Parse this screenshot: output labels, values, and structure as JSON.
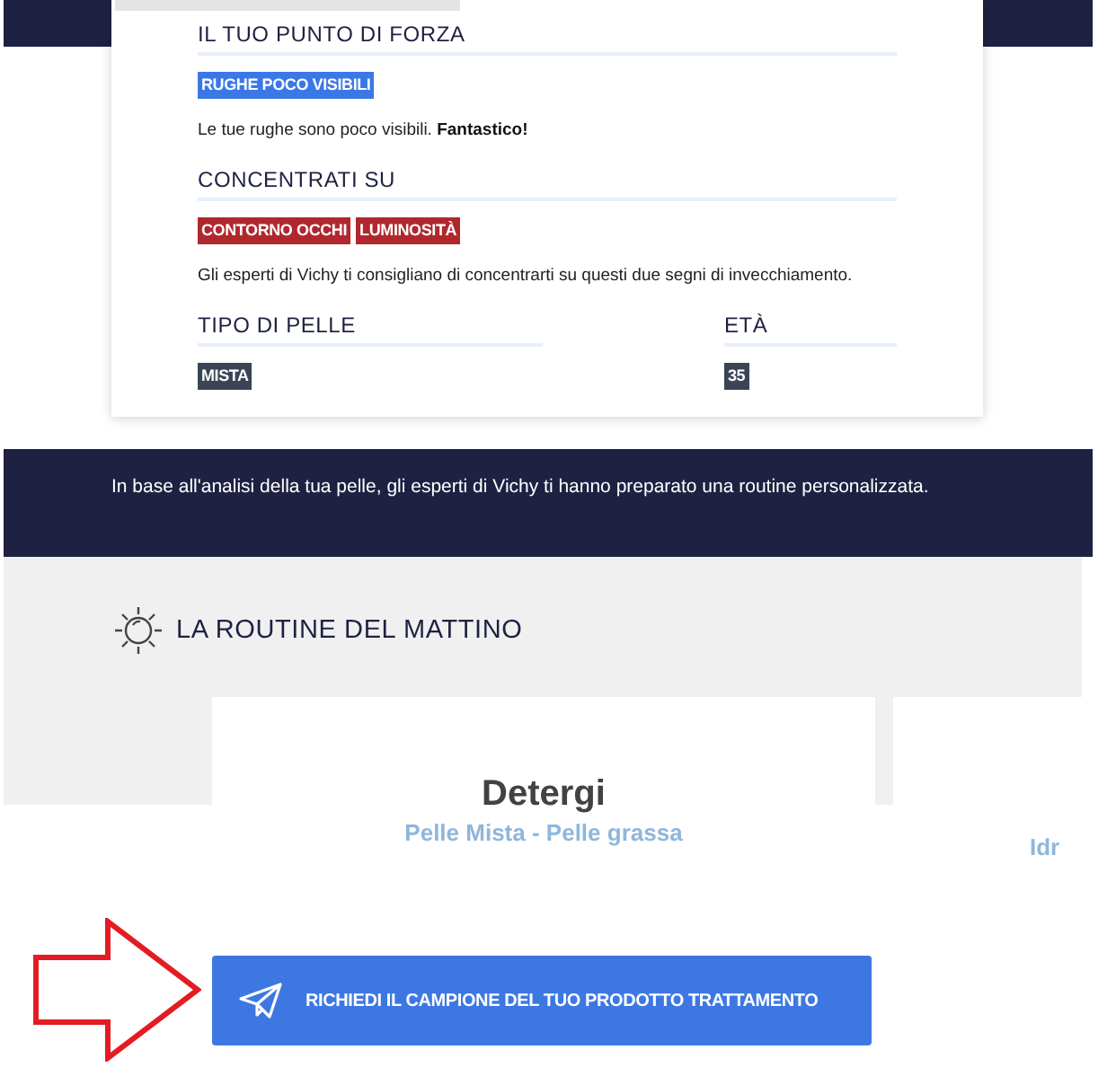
{
  "profile_card": {
    "strength": {
      "heading": "IL TUO PUNTO DI FORZA",
      "tags": [
        {
          "label": "RUGHE POCO VISIBILI",
          "color": "#3b78e7"
        }
      ],
      "text": "Le tue rughe sono poco visibili. **Fantastico!**"
    },
    "focus": {
      "heading": "CONCENTRATI SU",
      "tags": [
        {
          "label": "CONTORNO OCCHI",
          "color": "#b0282d"
        },
        {
          "label": "LUMINOSITÀ",
          "color": "#b0282d"
        }
      ],
      "text": "Gli esperti di Vichy ti consigliano di concentrarti su questi due segni di invecchiamento."
    },
    "skin_type": {
      "heading": "TIPO DI PELLE",
      "value": "MISTA"
    },
    "age": {
      "heading": "ETÀ",
      "value": "35"
    }
  },
  "intro_banner": {
    "text": "In base all'analisi della tua pelle, gli esperti di Vichy ti hanno preparato una routine personalizzata."
  },
  "morning_routine": {
    "title": "LA ROUTINE DEL MATTINO",
    "products": [
      {
        "title": "Detergi",
        "subtitle": "Pelle Mista - Pelle grassa"
      },
      {
        "subtitle": "Idr"
      }
    ]
  },
  "sample_button": {
    "label": "RICHIEDI IL CAMPIONE DEL TUO PRODOTTO TRATTAMENTO"
  }
}
